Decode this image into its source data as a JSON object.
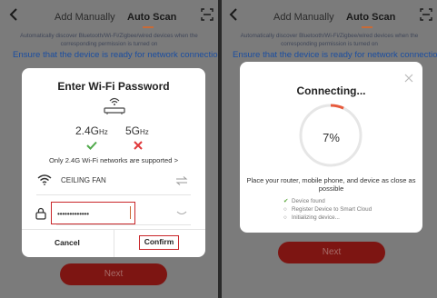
{
  "left": {
    "header": {
      "tab_manual": "Add Manually",
      "tab_auto": "Auto Scan"
    },
    "description": "Automatically discover Bluetooth/Wi-Fi/Zigbee/wired devices when the corresponding permission is turned on",
    "ensure": "Ensure that the device is ready for network connection.",
    "wifi_dialog": {
      "title": "Enter Wi-Fi Password",
      "band_24": "2.4G",
      "band_24_unit": "Hz",
      "band_5": "5G",
      "band_5_unit": "Hz",
      "support_note": "Only 2.4G Wi-Fi networks are supported",
      "support_chevron": ">",
      "ssid": "CEILING FAN",
      "password_value": "•••••••••••••",
      "cancel_label": "Cancel",
      "confirm_label": "Confirm"
    },
    "next_label": "Next"
  },
  "right": {
    "header": {
      "tab_manual": "Add Manually",
      "tab_auto": "Auto Scan"
    },
    "description": "Automatically discover Bluetooth/Wi-Fi/Zigbee/wired devices when the corresponding permission is turned on",
    "ensure": "Ensure that the device is ready for network connection. >",
    "connecting_dialog": {
      "title": "Connecting...",
      "progress_text": "7%",
      "progress": 0.07,
      "instruction": "Place your router, mobile phone, and device as close as possible",
      "steps": [
        {
          "label": "Device found",
          "state": "done"
        },
        {
          "label": "Register Device to Smart Cloud",
          "state": "pending"
        },
        {
          "label": "Initializing device...",
          "state": "pending"
        }
      ]
    },
    "next_label": "Next"
  },
  "colors": {
    "overlay": "#7b7b7b",
    "accent": "#c96a36",
    "next_button": "#7d1512",
    "link_blue": "#1b4ea0",
    "highlight_red": "#c9262a",
    "check_green": "#4fa94a",
    "cross_red": "#e0383a"
  },
  "icons": [
    "back-arrow-icon",
    "scan-icon",
    "router-icon",
    "check-icon",
    "cross-icon",
    "wifi-icon",
    "switch-network-icon",
    "lock-icon",
    "eye-closed-icon",
    "close-icon",
    "progress-ring-icon"
  ]
}
